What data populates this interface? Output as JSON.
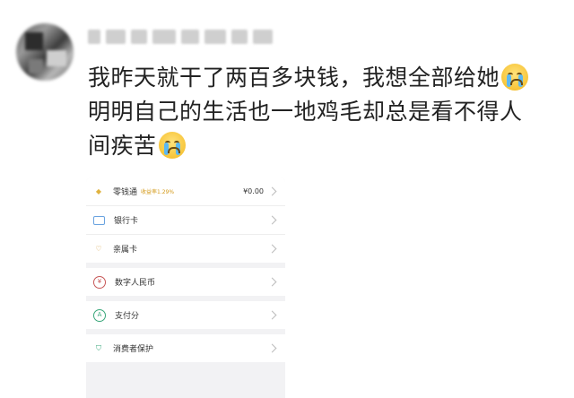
{
  "post": {
    "line1": "我昨天就干了两百多块钱，我想全部给她",
    "line2": "明明自己的生活也一地鸡毛却总是看不得人",
    "line3": "间疾苦"
  },
  "wallet": {
    "items": [
      {
        "label": "零钱通",
        "badge": "收益率1.29%",
        "value": "¥0.00",
        "icon": "gem-icon"
      },
      {
        "label": "银行卡",
        "icon": "bank-card-icon"
      },
      {
        "label": "亲属卡",
        "icon": "family-card-icon"
      },
      {
        "label": "数字人民币",
        "icon": "digital-yuan-icon"
      },
      {
        "label": "支付分",
        "icon": "pay-score-icon"
      },
      {
        "label": "消费者保护",
        "icon": "consumer-protection-icon"
      }
    ]
  }
}
